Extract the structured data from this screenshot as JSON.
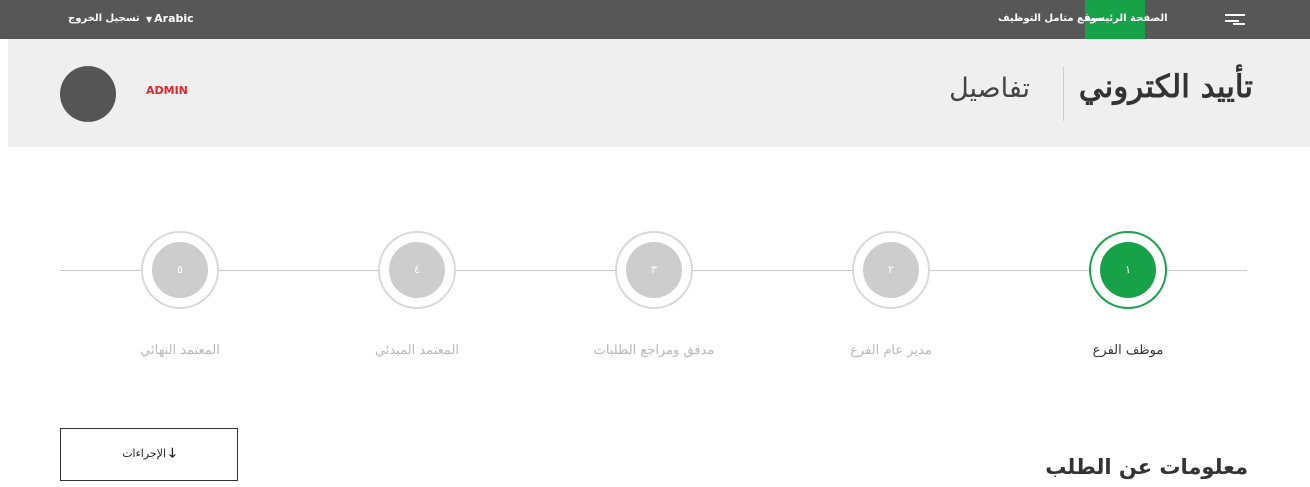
{
  "topbar": {
    "menu_icon": "hamburger-icon",
    "home_label": "الصفحة الرئيسية",
    "site_label": "موقع متامل التوظيف",
    "language_label": "Arabic",
    "language_caret_icon": "chevron-down-icon",
    "logout_label": "تسجيل الخروج",
    "colors": {
      "bar": "#575757",
      "home_bg": "#17a24a"
    }
  },
  "header": {
    "title": "تأييد الكتروني",
    "subtitle": "تفاصيل",
    "user_name": "ADMIN",
    "user_name_color": "#e0252e"
  },
  "stepper": {
    "steps": [
      {
        "number": "١",
        "label": "موظف الفرع",
        "active": true
      },
      {
        "number": "٢",
        "label": "مدير عام الفرع",
        "active": false
      },
      {
        "number": "٣",
        "label": "مدقق ومراجع الطلبات",
        "active": false
      },
      {
        "number": "٤",
        "label": "المعتمد المبدئي",
        "active": false
      },
      {
        "number": "٥",
        "label": "المعتمد النهائي",
        "active": false
      }
    ],
    "active_color": "#17a24a",
    "inactive_color": "#cdcdcd"
  },
  "main": {
    "section_title": "معلومات عن الطلب",
    "actions_label": "الإجراءات",
    "actions_icon": "arrow-down-icon"
  }
}
